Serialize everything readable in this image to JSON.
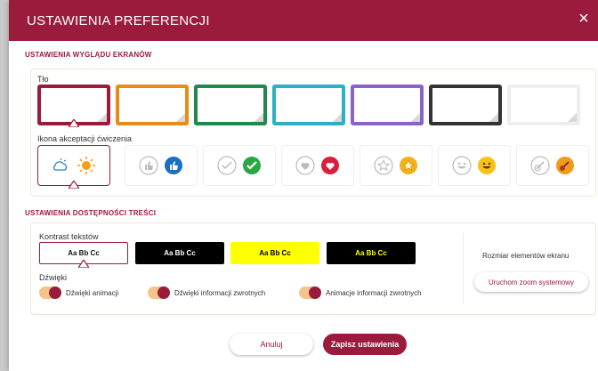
{
  "dialog": {
    "title": "USTAWIENIA PREFERENCJI",
    "close_symbol": "×"
  },
  "screen_section": {
    "title": "USTAWIENIA WYGLĄDU EKRANÓW",
    "background_label": "Tło",
    "background_colors": [
      "#9a1b3c",
      "#e38e1a",
      "#1f8a4c",
      "#2bb0c4",
      "#8a63c4",
      "#333333",
      "#eeeeee"
    ],
    "icon_label": "Ikona akceptacji ćwiczenia",
    "icon_sets": [
      "cloud-sun",
      "thumbs-up",
      "check",
      "heart",
      "star",
      "smiley",
      "guitar"
    ]
  },
  "access_section": {
    "title": "USTAWIENIA DOSTĘPNOŚCI TREŚCI",
    "contrast_label": "Kontrast tekstów",
    "contrast_options": [
      {
        "text": "Aa Bb Cc",
        "bg": "#ffffff",
        "fg": "#111111"
      },
      {
        "text": "Aa Bb Cc",
        "bg": "#000000",
        "fg": "#ffffff"
      },
      {
        "text": "Aa Bb Cc",
        "bg": "#ffff00",
        "fg": "#000000"
      },
      {
        "text": "Aa Bb Cc",
        "bg": "#000000",
        "fg": "#ffff00"
      }
    ],
    "sounds_label": "Dźwięki",
    "toggles": [
      "Dźwięki animacji",
      "Dźwięki informacji zwrotnych",
      "Animacje informacji zwrotnych"
    ],
    "zoom_label": "Rozmiar elementów ekranu",
    "zoom_button": "Uruchom zoom systemowy"
  },
  "footer": {
    "cancel": "Anuluj",
    "save": "Zapisz ustawienia"
  },
  "colors": {
    "accent": "#9a1b3c",
    "toggle_track": "#f4c48a"
  }
}
